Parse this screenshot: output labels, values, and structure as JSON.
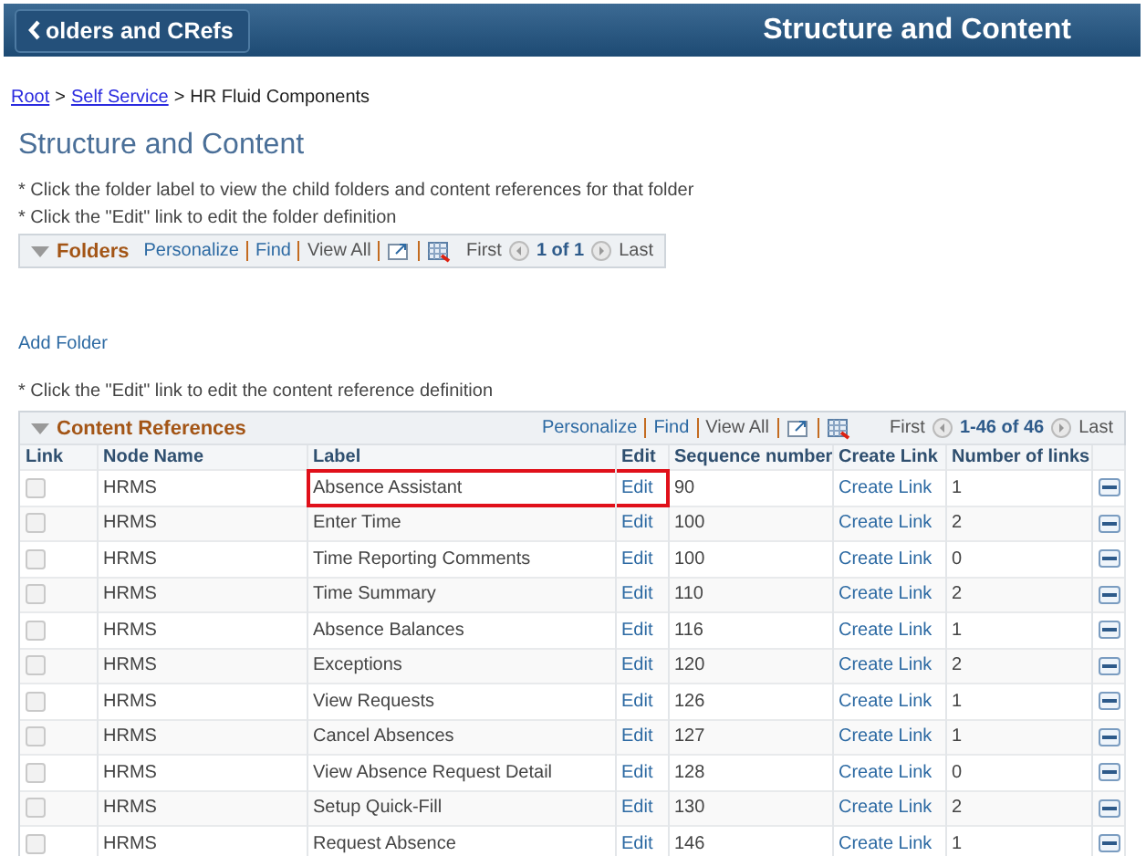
{
  "header": {
    "back_button": "olders and CRefs",
    "title": "Structure and Content"
  },
  "breadcrumb": {
    "separator": ">",
    "items": [
      {
        "text": "Root",
        "link": true
      },
      {
        "text": "Self Service",
        "link": true
      },
      {
        "text": "HR Fluid Components",
        "link": false
      }
    ]
  },
  "page_title": "Structure and Content",
  "folder_notes": [
    "* Click the folder label to view the child folders and content references for that folder",
    "* Click the \"Edit\" link to edit the folder definition"
  ],
  "folders_grid": {
    "title": "Folders",
    "personalize": "Personalize",
    "find": "Find",
    "view_all": "View All",
    "first": "First",
    "range": "1 of 1",
    "last": "Last"
  },
  "add_folder": "Add Folder",
  "content_note": "* Click the \"Edit\" link to edit the content reference definition",
  "content_grid": {
    "title": "Content References",
    "personalize": "Personalize",
    "find": "Find",
    "view_all": "View All",
    "first": "First",
    "range": "1-46 of 46",
    "last": "Last",
    "columns": [
      "Link",
      "Node Name",
      "Label",
      "Edit",
      "Sequence number",
      "Create Link",
      "Number of links"
    ],
    "rows": [
      {
        "checked": false,
        "node": "HRMS",
        "label": "Absence Assistant",
        "edit": "Edit",
        "sequence": "90",
        "create": "Create Link",
        "links": "1",
        "highlighted": true
      },
      {
        "checked": false,
        "node": "HRMS",
        "label": "Enter Time",
        "edit": "Edit",
        "sequence": "100",
        "create": "Create Link",
        "links": "2",
        "highlighted": false
      },
      {
        "checked": false,
        "node": "HRMS",
        "label": "Time Reporting Comments",
        "edit": "Edit",
        "sequence": "100",
        "create": "Create Link",
        "links": "0",
        "highlighted": false
      },
      {
        "checked": false,
        "node": "HRMS",
        "label": "Time Summary",
        "edit": "Edit",
        "sequence": "110",
        "create": "Create Link",
        "links": "2",
        "highlighted": false
      },
      {
        "checked": false,
        "node": "HRMS",
        "label": "Absence Balances",
        "edit": "Edit",
        "sequence": "116",
        "create": "Create Link",
        "links": "1",
        "highlighted": false
      },
      {
        "checked": false,
        "node": "HRMS",
        "label": "Exceptions",
        "edit": "Edit",
        "sequence": "120",
        "create": "Create Link",
        "links": "2",
        "highlighted": false
      },
      {
        "checked": false,
        "node": "HRMS",
        "label": "View Requests",
        "edit": "Edit",
        "sequence": "126",
        "create": "Create Link",
        "links": "1",
        "highlighted": false
      },
      {
        "checked": false,
        "node": "HRMS",
        "label": "Cancel Absences",
        "edit": "Edit",
        "sequence": "127",
        "create": "Create Link",
        "links": "1",
        "highlighted": false
      },
      {
        "checked": false,
        "node": "HRMS",
        "label": "View Absence Request Detail",
        "edit": "Edit",
        "sequence": "128",
        "create": "Create Link",
        "links": "0",
        "highlighted": false
      },
      {
        "checked": false,
        "node": "HRMS",
        "label": "Setup Quick-Fill",
        "edit": "Edit",
        "sequence": "130",
        "create": "Create Link",
        "links": "2",
        "highlighted": false
      },
      {
        "checked": false,
        "node": "HRMS",
        "label": "Request Absence",
        "edit": "Edit",
        "sequence": "146",
        "create": "Create Link",
        "links": "1",
        "highlighted": false
      }
    ]
  }
}
